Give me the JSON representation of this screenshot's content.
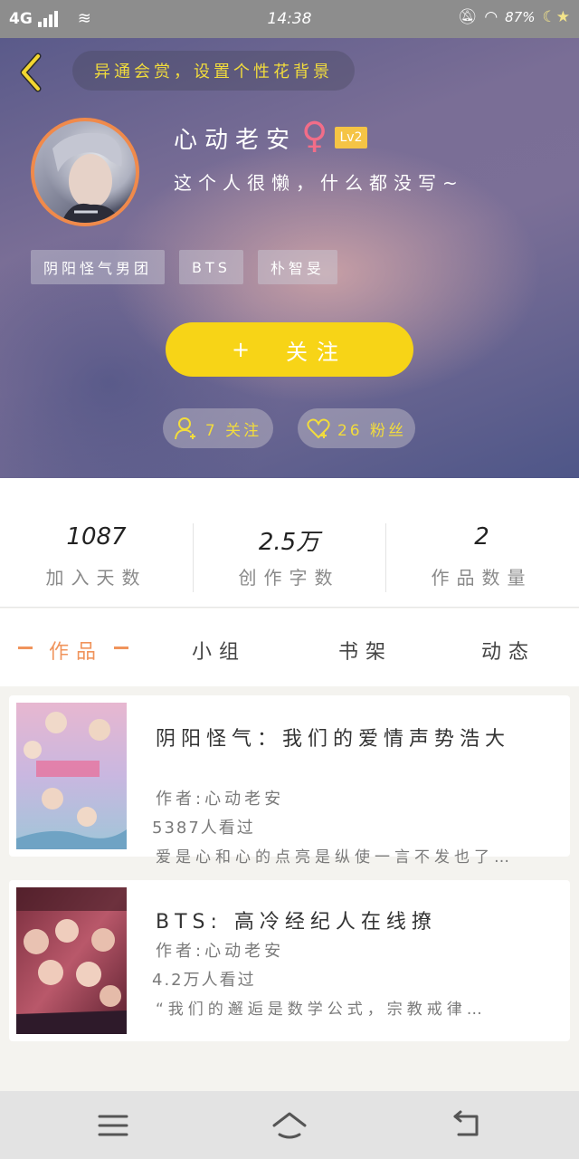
{
  "status_bar": {
    "network": "4G",
    "time": "14:38",
    "battery": "87%"
  },
  "header": {
    "bg_hint": "异通会赏，设置个性花背景",
    "username": "心动老安",
    "gender_symbol": "♀",
    "level": "Lv2",
    "bio": "这个人很懒，什么都没写~",
    "tags": [
      "阴阳怪气男团",
      "BTS",
      "朴智旻"
    ],
    "follow_button": {
      "icon": "+",
      "label": "关注"
    },
    "following": "7 关注",
    "followers": "26 粉丝"
  },
  "stats": [
    {
      "value": "1087",
      "label": "加入天数"
    },
    {
      "value": "2.5万",
      "label": "创作字数"
    },
    {
      "value": "2",
      "label": "作品数量"
    }
  ],
  "tabs": [
    "作品",
    "小组",
    "书架",
    "动态"
  ],
  "works": [
    {
      "title": "阴阳怪气：我们的爱情声势浩大",
      "author": "作者:心动老安",
      "reads": "5387人看过",
      "description": "爱是心和心的点亮是纵使一言不发也了…"
    },
    {
      "title": "BTS: 高冷经纪人在线撩",
      "author": "作者:心动老安",
      "reads": "4.2万人看过",
      "description": "“我们的邂逅是数学公式，宗教戒律…"
    }
  ],
  "colors": {
    "accent": "#f7d417",
    "tab_active": "#f0945c",
    "avatar_ring": "#f08a4b"
  }
}
